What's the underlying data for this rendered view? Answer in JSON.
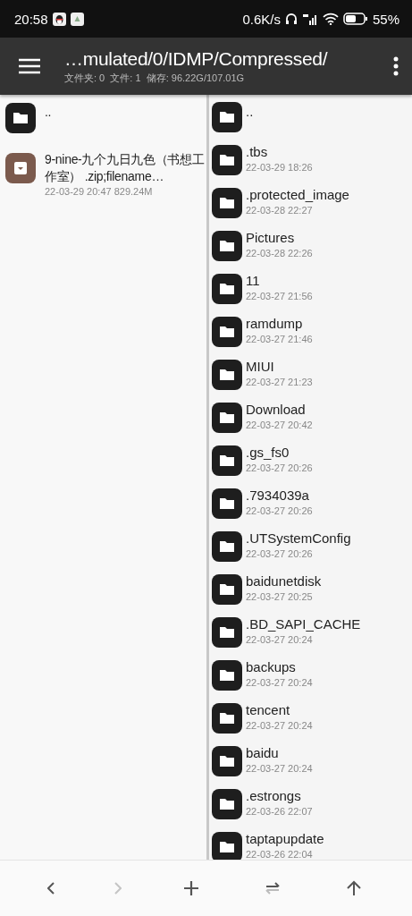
{
  "status_bar": {
    "time": "20:58",
    "speed": "0.6K/s",
    "battery": "55%"
  },
  "header": {
    "path": "…mulated/0/IDMP/Compressed/",
    "info": "文件夹: 0  文件: 1  储存: 96.22G/107.01G"
  },
  "left_pane": {
    "items": [
      {
        "kind": "folder",
        "name": ".."
      },
      {
        "kind": "archive",
        "name": "9-nine-九个九日九色（书想工作室） .zip;filename…",
        "meta": "22-03-29 20:47  829.24M"
      }
    ]
  },
  "right_pane": {
    "items": [
      {
        "kind": "folder",
        "name": ".."
      },
      {
        "kind": "folder",
        "name": ".tbs",
        "meta": "22-03-29 18:26"
      },
      {
        "kind": "folder",
        "name": ".protected_image",
        "meta": "22-03-28 22:27"
      },
      {
        "kind": "folder",
        "name": "Pictures",
        "meta": "22-03-28 22:26"
      },
      {
        "kind": "folder",
        "name": "11",
        "meta": "22-03-27 21:56"
      },
      {
        "kind": "folder",
        "name": "ramdump",
        "meta": "22-03-27 21:46"
      },
      {
        "kind": "folder",
        "name": "MIUI",
        "meta": "22-03-27 21:23"
      },
      {
        "kind": "folder",
        "name": "Download",
        "meta": "22-03-27 20:42"
      },
      {
        "kind": "folder",
        "name": ".gs_fs0",
        "meta": "22-03-27 20:26"
      },
      {
        "kind": "folder",
        "name": ".7934039a",
        "meta": "22-03-27 20:26"
      },
      {
        "kind": "folder",
        "name": ".UTSystemConfig",
        "meta": "22-03-27 20:26"
      },
      {
        "kind": "folder",
        "name": "baidunetdisk",
        "meta": "22-03-27 20:25"
      },
      {
        "kind": "folder",
        "name": ".BD_SAPI_CACHE",
        "meta": "22-03-27 20:24"
      },
      {
        "kind": "folder",
        "name": "backups",
        "meta": "22-03-27 20:24"
      },
      {
        "kind": "folder",
        "name": "tencent",
        "meta": "22-03-27 20:24"
      },
      {
        "kind": "folder",
        "name": "baidu",
        "meta": "22-03-27 20:24"
      },
      {
        "kind": "folder",
        "name": ".estrongs",
        "meta": "22-03-26 22:07"
      },
      {
        "kind": "folder",
        "name": "taptapupdate",
        "meta": "22-03-26 22:04"
      }
    ]
  },
  "bottom_bar": {
    "buttons": [
      {
        "kind": "back",
        "disabled": false
      },
      {
        "kind": "forward",
        "disabled": true
      },
      {
        "kind": "add",
        "disabled": false
      },
      {
        "kind": "swap",
        "disabled": false
      },
      {
        "kind": "up",
        "disabled": false
      }
    ]
  }
}
